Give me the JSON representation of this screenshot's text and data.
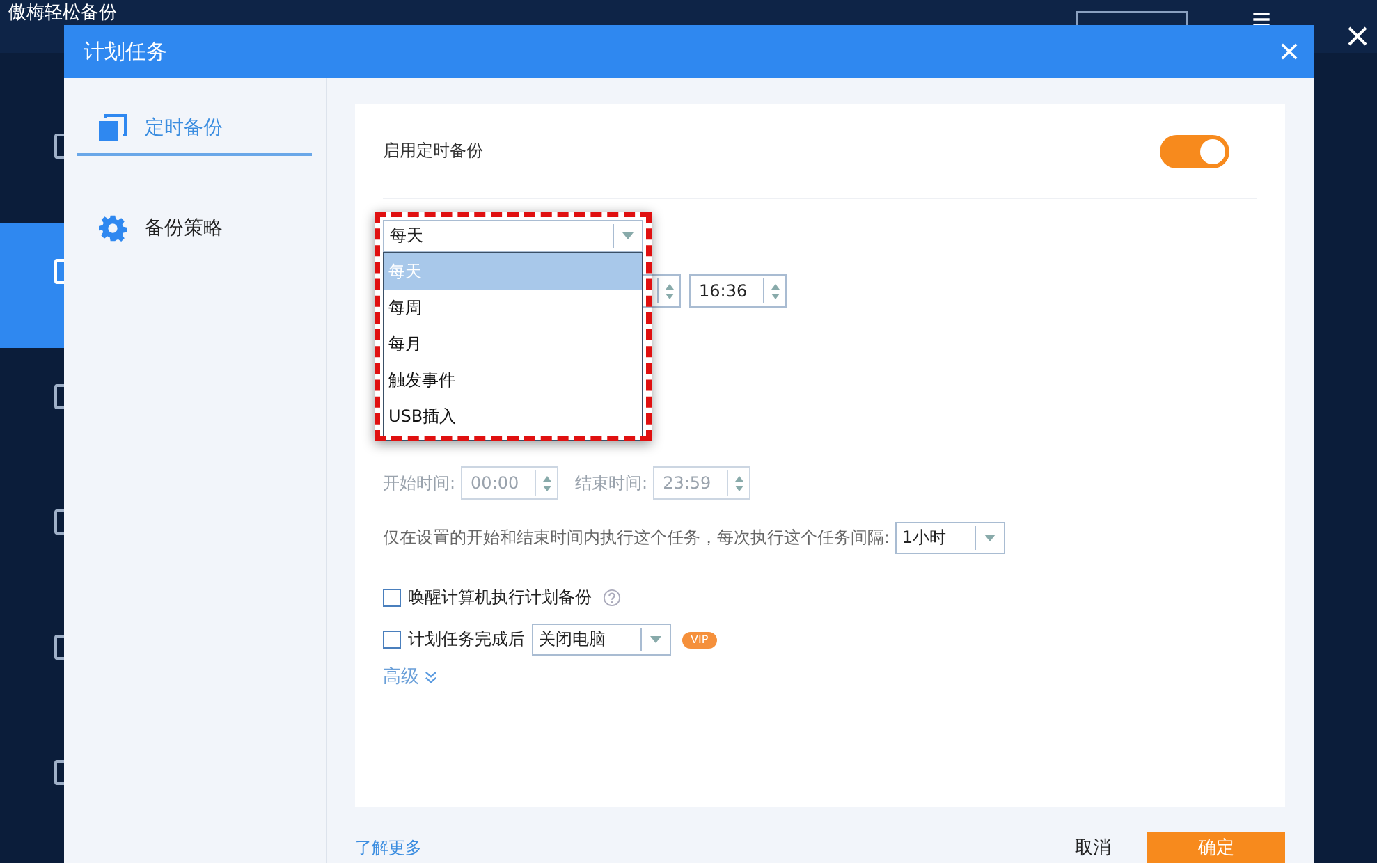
{
  "app": {
    "title": "傲梅轻松备份",
    "nav": [
      {
        "selected": false
      },
      {
        "selected": true
      },
      {
        "selected": false
      },
      {
        "selected": false
      },
      {
        "selected": false
      },
      {
        "selected": false
      }
    ]
  },
  "dialog": {
    "title": "计划任务"
  },
  "sidebar": {
    "items": [
      {
        "label": "定时备份",
        "selected": true,
        "kind": "schedule"
      },
      {
        "label": "备份策略",
        "selected": false,
        "kind": "strategy"
      }
    ]
  },
  "enable": {
    "label": "启用定时备份",
    "on": true
  },
  "frequency": {
    "value": "每天",
    "expanded": true,
    "options": [
      {
        "label": "每天",
        "selected": true
      },
      {
        "label": "每周",
        "selected": false
      },
      {
        "label": "每月",
        "selected": false
      },
      {
        "label": "触发事件",
        "selected": false
      },
      {
        "label": "USB插入",
        "selected": false
      }
    ]
  },
  "time": {
    "value": "16:36"
  },
  "range": {
    "start_label": "开始时间:",
    "start": "00:00",
    "end_label": "结束时间:",
    "end": "23:59",
    "disabled": true
  },
  "interval": {
    "label": "仅在设置的开始和结束时间内执行这个任务，每次执行这个任务间隔:",
    "value": "1小时"
  },
  "options": [
    {
      "kind": "help",
      "label": "唤醒计算机执行计划备份",
      "checked": false
    },
    {
      "kind": "action",
      "label": "计划任务完成后",
      "checked": false,
      "value": "关闭电脑",
      "badge": "VIP"
    }
  ],
  "advanced": {
    "label": "高级",
    "expanded": false
  },
  "footer": {
    "link": "了解更多",
    "cancel": "取消",
    "ok": "确定"
  }
}
